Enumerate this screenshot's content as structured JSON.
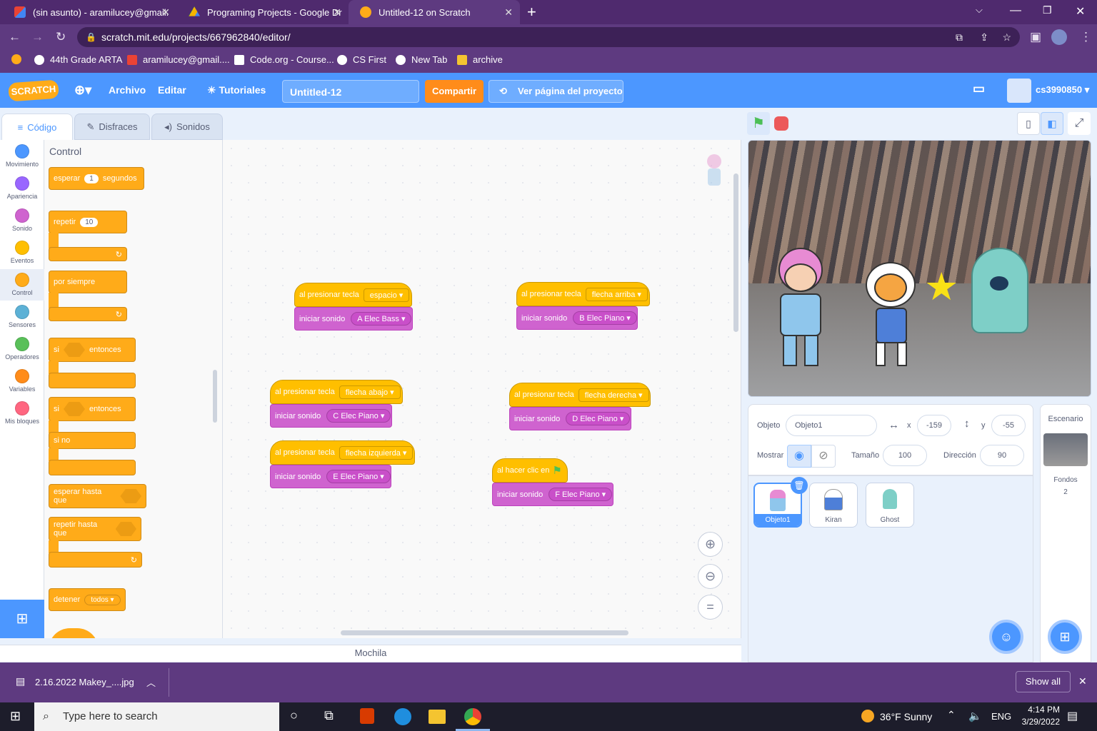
{
  "browser": {
    "tabs": [
      {
        "title": "(sin asunto) - aramilucey@gmail.",
        "icon": "gmail-icon"
      },
      {
        "title": "Programing Projects - Google Dr",
        "icon": "google-drive-icon"
      },
      {
        "title": "Untitled-12 on Scratch",
        "icon": "scratch-icon"
      }
    ],
    "url": "scratch.mit.edu/projects/667962840/editor/",
    "bookmarks": [
      "44th Grade ARTA",
      "aramilucey@gmail....",
      "Code.org - Course...",
      "CS First",
      "New Tab",
      "archive"
    ]
  },
  "menubar": {
    "logo": "SCRATCH",
    "file": "Archivo",
    "edit": "Editar",
    "tutorials": "Tutoriales",
    "project_title": "Untitled-12",
    "share": "Compartir",
    "see_project": "Ver página del proyecto",
    "username": "cs3990850"
  },
  "editor_tabs": {
    "code": "Código",
    "costumes": "Disfraces",
    "sounds": "Sonidos"
  },
  "categories": [
    {
      "label": "Movimiento",
      "color": "#4c97ff"
    },
    {
      "label": "Apariencia",
      "color": "#9966ff"
    },
    {
      "label": "Sonido",
      "color": "#cf63cf"
    },
    {
      "label": "Eventos",
      "color": "#ffbf00"
    },
    {
      "label": "Control",
      "color": "#ffab19"
    },
    {
      "label": "Sensores",
      "color": "#5cb1d6"
    },
    {
      "label": "Operadores",
      "color": "#59c059"
    },
    {
      "label": "Variables",
      "color": "#ff8c1a"
    },
    {
      "label": "Mis bloques",
      "color": "#ff6680"
    }
  ],
  "palette": {
    "heading": "Control",
    "wait": "esperar",
    "wait_val": "1",
    "wait_unit": "segundos",
    "repeat": "repetir",
    "repeat_val": "10",
    "forever": "por siempre",
    "if": "si",
    "then": "entonces",
    "else": "si no",
    "wait_until": "esperar hasta que",
    "repeat_until": "repetir hasta que",
    "stop": "detener",
    "stop_opt": "todos"
  },
  "scripts": [
    {
      "hat": "al presionar tecla",
      "key": "espacio",
      "action": "iniciar sonido",
      "sound": "A Elec Bass"
    },
    {
      "hat": "al presionar tecla",
      "key": "flecha arriba",
      "action": "iniciar sonido",
      "sound": "B Elec Piano"
    },
    {
      "hat": "al presionar tecla",
      "key": "flecha abajo",
      "action": "iniciar sonido",
      "sound": "C Elec Piano"
    },
    {
      "hat": "al presionar tecla",
      "key": "flecha derecha",
      "action": "iniciar sonido",
      "sound": "D Elec Piano"
    },
    {
      "hat": "al presionar tecla",
      "key": "flecha izquierda",
      "action": "iniciar sonido",
      "sound": "E Elec Piano"
    },
    {
      "hat": "al hacer clic en",
      "key": "",
      "action": "iniciar sonido",
      "sound": "F Elec Piano"
    }
  ],
  "backpack": "Mochila",
  "sprite_info": {
    "sprite_label": "Objeto",
    "sprite_name": "Objeto1",
    "x_label": "x",
    "x": "-159",
    "y_label": "y",
    "y": "-55",
    "show_label": "Mostrar",
    "size_label": "Tamaño",
    "size": "100",
    "direction_label": "Dirección",
    "direction": "90"
  },
  "sprites": [
    {
      "name": "Objeto1",
      "selected": true
    },
    {
      "name": "Kiran",
      "selected": false
    },
    {
      "name": "Ghost",
      "selected": false
    }
  ],
  "stage_panel": {
    "title": "Escenario",
    "backdrops_label": "Fondos",
    "backdrops_count": "2"
  },
  "download": {
    "file": "2.16.2022 Makey_....jpg",
    "show_all": "Show all"
  },
  "taskbar": {
    "search_placeholder": "Type here to search",
    "weather": "36°F  Sunny",
    "lang": "ENG",
    "time": "4:14 PM",
    "date": "3/29/2022"
  }
}
